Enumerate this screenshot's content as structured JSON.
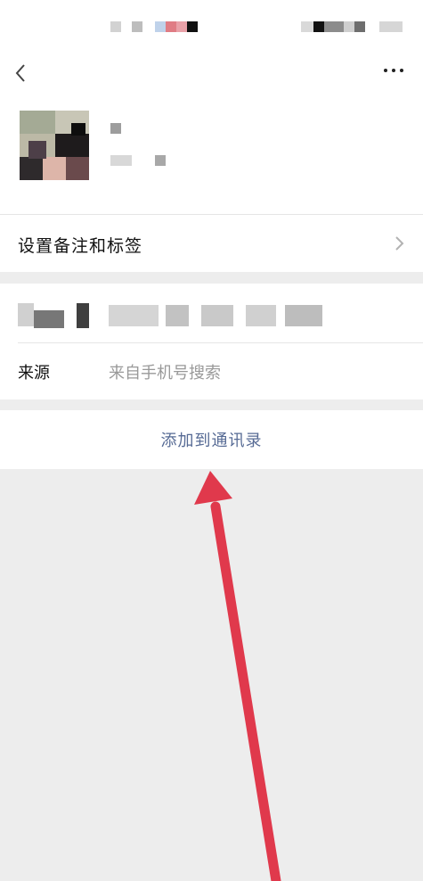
{
  "remark": {
    "label": "设置备注和标签"
  },
  "source": {
    "label": "来源",
    "value": "来自手机号搜索"
  },
  "action": {
    "add_contact_label": "添加到通讯录"
  },
  "colors": {
    "link": "#576b95",
    "arrow": "#e0394c",
    "background": "#ededed"
  }
}
